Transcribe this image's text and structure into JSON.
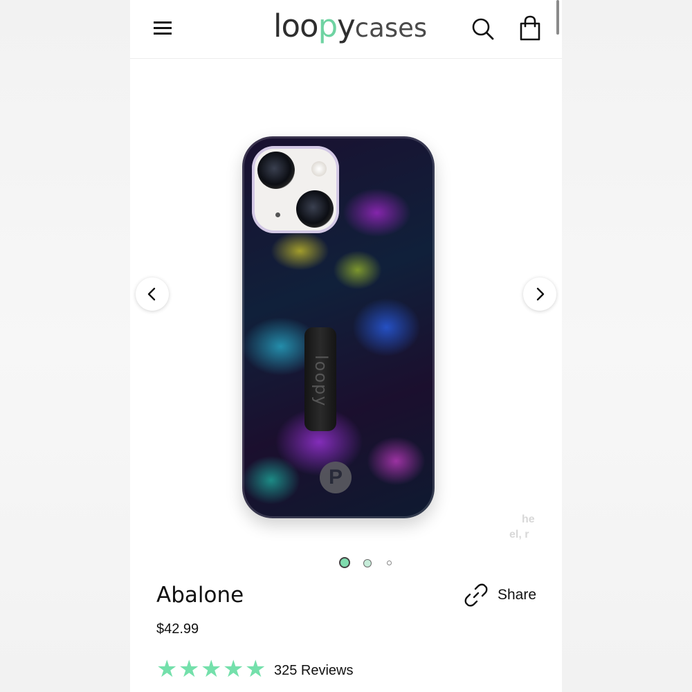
{
  "header": {
    "logo_loopy_a": "loo",
    "logo_loopy_p": "p",
    "logo_loopy_b": "y",
    "logo_cases": "cases",
    "icons": [
      "menu-icon",
      "search-icon",
      "shopping-bag-icon"
    ]
  },
  "carousel": {
    "strap_text": "loopy",
    "strap_logo": "P",
    "ghost_text_line1": "he",
    "ghost_text_line2": "el, r",
    "slide_count": 3,
    "active_slide": 1,
    "icons": [
      "chevron-left-icon",
      "chevron-right-icon"
    ]
  },
  "product": {
    "title": "Abalone",
    "price": "$42.99",
    "share_label": "Share",
    "rating": 5,
    "reviews_label": "325 Reviews",
    "accent_color": "#74e0ab"
  }
}
